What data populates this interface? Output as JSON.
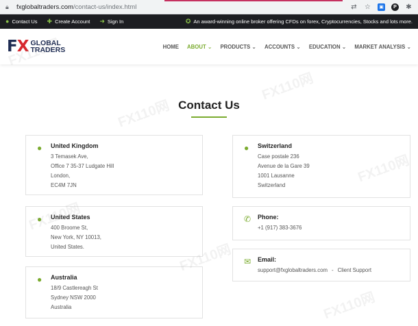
{
  "browser": {
    "url_host": "fxglobaltraders.com",
    "url_path": "/contact-us/index.html"
  },
  "topbar": {
    "contact_label": "Contact Us",
    "create_account_label": "Create Account",
    "sign_in_label": "Sign In",
    "promo_text": "An award-winning online broker offering CFDs on forex, Cryptocurrencies, Stocks and lots more."
  },
  "logo": {
    "fx": "F",
    "x": "X",
    "word1": "GLOBAL",
    "word2": "TRADERS"
  },
  "nav": {
    "items": [
      {
        "label": "HOME"
      },
      {
        "label": "ABOUT",
        "chevron": "⌄"
      },
      {
        "label": "PRODUCTS",
        "chevron": "⌄"
      },
      {
        "label": "ACCOUNTS",
        "chevron": "⌄"
      },
      {
        "label": "EDUCATION",
        "chevron": "⌄"
      },
      {
        "label": "MARKET ANALYSIS",
        "chevron": "⌄"
      }
    ]
  },
  "page": {
    "title": "Contact Us"
  },
  "offices": {
    "uk": {
      "title": "United Kingdom",
      "lines": [
        "3 Temasek Ave,",
        "Office 7 35-37 Ludgate Hill",
        "London,",
        "EC4M 7JN"
      ]
    },
    "us": {
      "title": "United States",
      "lines": [
        "400 Broome St,",
        "New York, NY 10013,",
        "United States."
      ]
    },
    "au": {
      "title": "Australia",
      "lines": [
        "18/9 Castlereagh St",
        "Sydney NSW 2000",
        "Australia"
      ]
    },
    "ch": {
      "title": "Switzerland",
      "lines": [
        "Case postale 236",
        "Avenue de la Gare 39",
        "1001 Lausanne",
        "Switzerland"
      ]
    }
  },
  "phone": {
    "title": "Phone:",
    "number": "+1 (917) 383-3676"
  },
  "email": {
    "title": "Email:",
    "address": "support@fxglobaltraders.com",
    "separator": "-",
    "support_label": "Client Support"
  },
  "watermark": {
    "text": "FX110网"
  },
  "colors": {
    "accent": "#7aab2e",
    "brand_navy": "#1d2b52",
    "brand_red": "#d7282f",
    "topbar_bg": "#1d1e22"
  }
}
